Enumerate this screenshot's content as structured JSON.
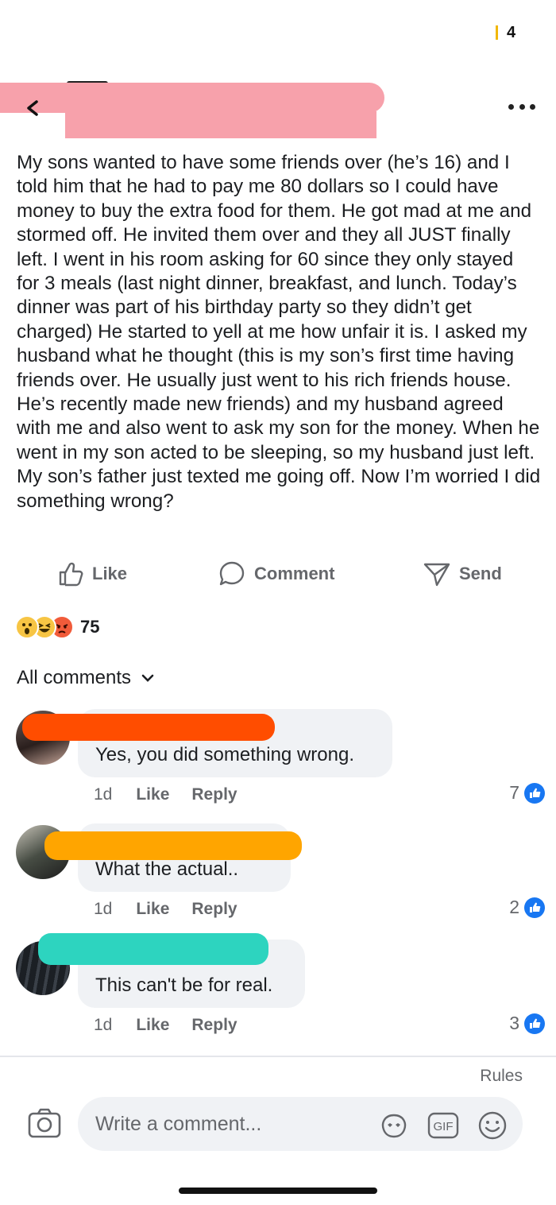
{
  "status": {
    "time_fragment": "4"
  },
  "header": {
    "more_icon": "more-dots-icon",
    "back_icon": "back-chevron-icon"
  },
  "post": {
    "text": "My sons wanted to have some friends over (he’s 16) and I told him that he had to pay me 80 dollars so I could have money to buy the extra food for them. He got mad at me and stormed off. He invited them over and they all JUST finally left. I went in his room asking for 60 since they only stayed for 3 meals (last night dinner, breakfast, and lunch. Today’s dinner was part of his birthday party so they didn’t get charged) He started to yell at me how unfair it is. I asked my husband what he thought (this is my son’s first time having friends over. He usually just went to his rich friends house. He’s recently made new friends) and my husband agreed with me and also went to ask my son for the money. When he went in my son acted to be sleeping, so my husband just left. My son’s father just texted me going off. Now I’m worried I did something wrong?"
  },
  "actions": {
    "like": "Like",
    "comment": "Comment",
    "send": "Send"
  },
  "reactions": {
    "count": "75",
    "types": [
      "wow",
      "haha",
      "angry"
    ]
  },
  "comments_header": {
    "label": "All comments"
  },
  "comments": [
    {
      "text": "Yes, you did something wrong.",
      "time": "1d",
      "like": "Like",
      "reply": "Reply",
      "likes": "7",
      "redact_color": "#ff4d00"
    },
    {
      "text": "What the actual..",
      "time": "1d",
      "like": "Like",
      "reply": "Reply",
      "likes": "2",
      "redact_color": "#ffa500"
    },
    {
      "text": "This can't be for real.",
      "time": "1d",
      "like": "Like",
      "reply": "Reply",
      "likes": "3",
      "redact_color": "#2dd4bf"
    }
  ],
  "footer": {
    "rules": "Rules",
    "placeholder": "Write a comment...",
    "gif": "GIF"
  },
  "colors": {
    "accent": "#1877f2",
    "bubble": "#f0f2f5",
    "header_redact": "#f7a1ab"
  }
}
